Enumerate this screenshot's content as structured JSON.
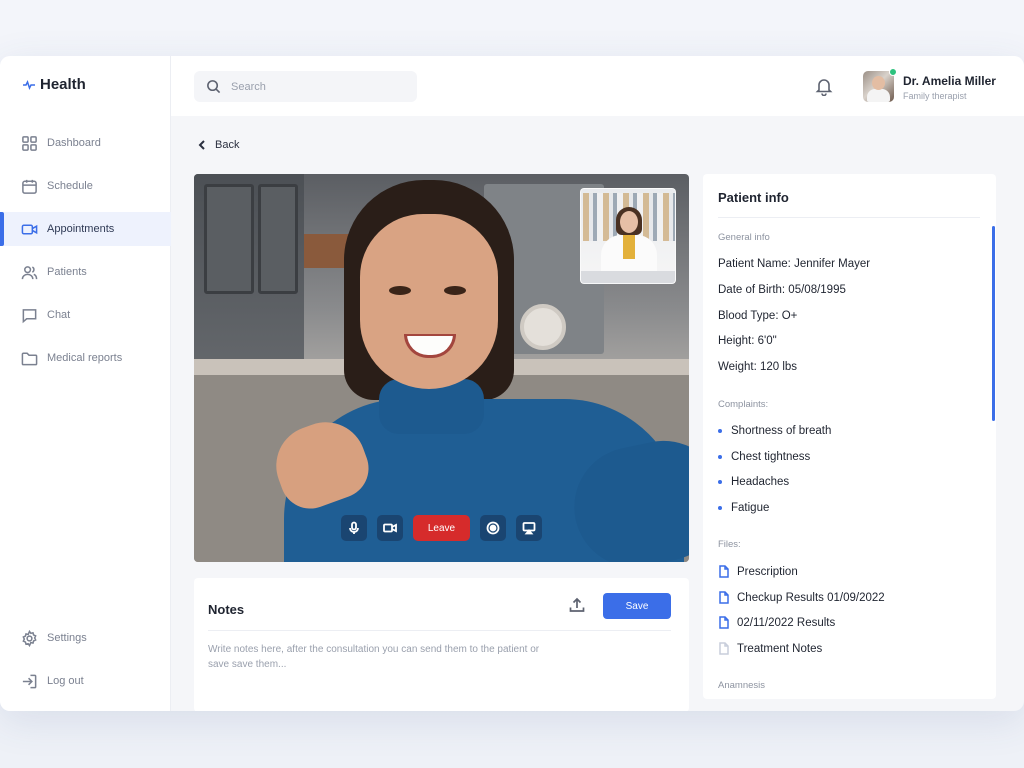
{
  "app": {
    "logo_text": "Health"
  },
  "sidebar": {
    "items": [
      {
        "label": "Dashboard",
        "icon": "dashboard-icon"
      },
      {
        "label": "Schedule",
        "icon": "calendar-icon"
      },
      {
        "label": "Appointments",
        "icon": "video-icon",
        "active": true
      },
      {
        "label": "Patients",
        "icon": "users-icon"
      },
      {
        "label": "Chat",
        "icon": "chat-icon"
      },
      {
        "label": "Medical reports",
        "icon": "folder-icon"
      }
    ],
    "bottom": [
      {
        "label": "Settings",
        "icon": "gear-icon"
      },
      {
        "label": "Log out",
        "icon": "logout-icon"
      }
    ]
  },
  "topbar": {
    "search_placeholder": "Search",
    "user_name": "Dr. Amelia Miller",
    "user_role": "Family therapist"
  },
  "back_label": "Back",
  "call": {
    "leave_label": "Leave"
  },
  "notes": {
    "title": "Notes",
    "save_label": "Save",
    "placeholder": "Write notes here, after the consultation you can send them to the patient or save save them..."
  },
  "patient": {
    "title": "Patient info",
    "general_label": "General info",
    "fields": [
      "Patient Name:  Jennifer Mayer",
      "Date of Birth:  05/08/1995",
      "Blood Type:  O+",
      "Height:  6'0\"",
      "Weight:  120 lbs"
    ],
    "complaints_label": "Complaints:",
    "complaints": [
      "Shortness of breath",
      "Chest tightness",
      "Headaches",
      "Fatigue"
    ],
    "files_label": "Files:",
    "files": [
      "Prescription",
      "Checkup Results 01/09/2022",
      "02/11/2022 Results",
      "Treatment Notes"
    ],
    "anamnesis_label": "Anamnesis"
  },
  "colors": {
    "accent": "#3b6ee8",
    "danger": "#d62b2b",
    "online": "#2ec27e"
  }
}
